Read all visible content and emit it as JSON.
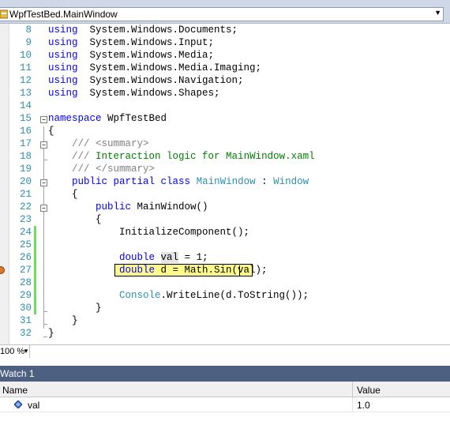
{
  "navigation_bar": {
    "type_combo_text": "WpfTestBed.MainWindow"
  },
  "editor": {
    "lines": [
      {
        "num": "8",
        "segments": [
          [
            "kw",
            "using"
          ],
          [
            "",
            "  System.Windows.Documents;"
          ]
        ]
      },
      {
        "num": "9",
        "segments": [
          [
            "kw",
            "using"
          ],
          [
            "",
            "  System.Windows.Input;"
          ]
        ]
      },
      {
        "num": "10",
        "segments": [
          [
            "kw",
            "using"
          ],
          [
            "",
            "  System.Windows.Media;"
          ]
        ]
      },
      {
        "num": "11",
        "segments": [
          [
            "kw",
            "using"
          ],
          [
            "",
            "  System.Windows.Media.Imaging;"
          ]
        ]
      },
      {
        "num": "12",
        "segments": [
          [
            "kw",
            "using"
          ],
          [
            "",
            "  System.Windows.Navigation;"
          ]
        ]
      },
      {
        "num": "13",
        "segments": [
          [
            "kw",
            "using"
          ],
          [
            "",
            "  System.Windows.Shapes;"
          ]
        ]
      },
      {
        "num": "14",
        "segments": []
      },
      {
        "num": "15",
        "segments": [
          [
            "kw",
            "namespace"
          ],
          [
            "",
            " WpfTestBed"
          ]
        ]
      },
      {
        "num": "16",
        "segments": [
          [
            "",
            "{"
          ]
        ]
      },
      {
        "num": "17",
        "segments": [
          [
            "",
            "    "
          ],
          [
            "cg",
            "///"
          ],
          [
            "cm",
            " "
          ],
          [
            "cg",
            "<summary>"
          ]
        ]
      },
      {
        "num": "18",
        "segments": [
          [
            "",
            "    "
          ],
          [
            "cg",
            "///"
          ],
          [
            "cm",
            " Interaction logic for MainWindow.xaml"
          ]
        ]
      },
      {
        "num": "19",
        "segments": [
          [
            "",
            "    "
          ],
          [
            "cg",
            "///"
          ],
          [
            "cm",
            " "
          ],
          [
            "cg",
            "</summary>"
          ]
        ]
      },
      {
        "num": "20",
        "segments": [
          [
            "",
            "    "
          ],
          [
            "kw",
            "public partial class"
          ],
          [
            "",
            " "
          ],
          [
            "ty",
            "MainWindow"
          ],
          [
            "",
            " : "
          ],
          [
            "ty",
            "Window"
          ]
        ]
      },
      {
        "num": "21",
        "segments": [
          [
            "",
            "    {"
          ]
        ]
      },
      {
        "num": "22",
        "segments": [
          [
            "",
            "        "
          ],
          [
            "kw",
            "public"
          ],
          [
            "",
            " MainWindow()"
          ]
        ]
      },
      {
        "num": "23",
        "segments": [
          [
            "",
            "        {"
          ]
        ]
      },
      {
        "num": "24",
        "segments": [
          [
            "",
            "            InitializeComponent();"
          ]
        ]
      },
      {
        "num": "25",
        "segments": []
      },
      {
        "num": "26",
        "segments": [
          [
            "",
            "            "
          ],
          [
            "kw",
            "double"
          ],
          [
            "",
            " "
          ],
          [
            "ch",
            "val"
          ],
          [
            "",
            " = 1;"
          ]
        ]
      },
      {
        "num": "27",
        "segments": [
          [
            "",
            "            "
          ],
          [
            "kw",
            "double"
          ],
          [
            "",
            " d = Math.Sin(val);"
          ]
        ]
      },
      {
        "num": "28",
        "segments": []
      },
      {
        "num": "29",
        "segments": [
          [
            "",
            "            "
          ],
          [
            "ty",
            "Console"
          ],
          [
            "",
            ".WriteLine(d.ToString());"
          ]
        ]
      },
      {
        "num": "30",
        "segments": [
          [
            "",
            "        }"
          ]
        ]
      },
      {
        "num": "31",
        "segments": [
          [
            "",
            "    }"
          ]
        ]
      },
      {
        "num": "32",
        "segments": [
          [
            "",
            "}"
          ]
        ]
      }
    ]
  },
  "zoom": {
    "level": "100 %"
  },
  "watch_window": {
    "title": "Watch 1",
    "columns": {
      "name": "Name",
      "value": "Value"
    },
    "rows": [
      {
        "name": "val",
        "value": "1.0"
      }
    ]
  },
  "colors": {
    "keyword": "#0000ff",
    "type": "#2b91af",
    "comment": "#008000",
    "line_number": "#2b91af",
    "current_statement": "#fffb8c",
    "changed_line_bar": "#6cdc5a",
    "watch_header": "#4d6082"
  },
  "icons": {
    "class": "class-icon",
    "breakpoint": "breakpoint-icon",
    "variable": "field-variable-icon"
  }
}
